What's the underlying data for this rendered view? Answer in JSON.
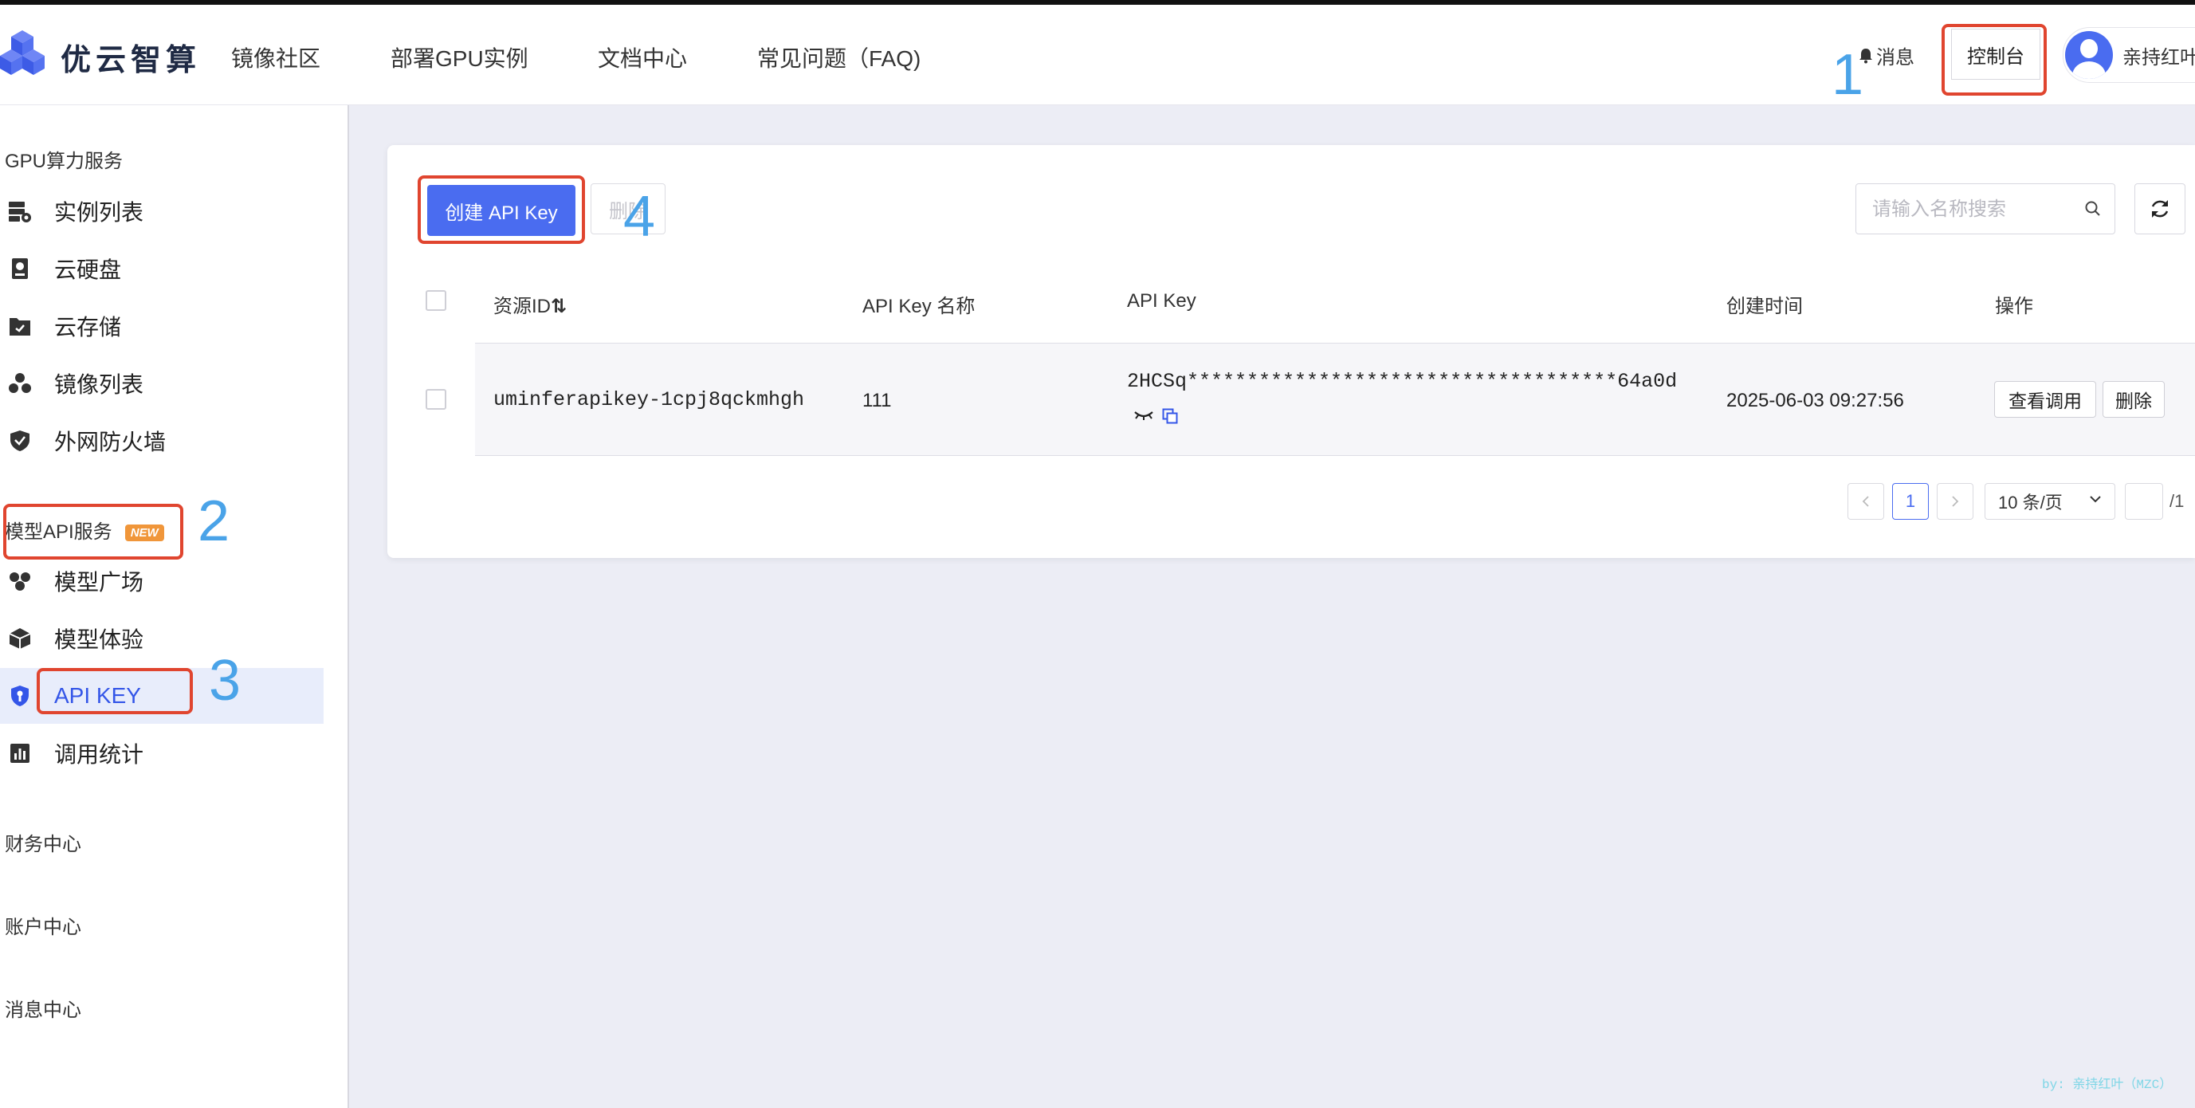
{
  "header": {
    "brand": "优云智算",
    "nav": [
      "镜像社区",
      "部署GPU实例",
      "文档中心",
      "常见问题（FAQ)"
    ],
    "messages_label": "消息",
    "console_label": "控制台",
    "username": "亲持红叶"
  },
  "sidebar": {
    "sections": {
      "gpu": "GPU算力服务",
      "model_api": "模型API服务",
      "finance": "财务中心",
      "account": "账户中心",
      "message": "消息中心"
    },
    "new_badge": "NEW",
    "gpu_items": [
      "实例列表",
      "云硬盘",
      "云存储",
      "镜像列表",
      "外网防火墙"
    ],
    "model_items": [
      "模型广场",
      "模型体验",
      "API KEY",
      "调用统计"
    ],
    "active_item": "API KEY"
  },
  "toolbar": {
    "create_label": "创建 API Key",
    "delete_label": "删除",
    "search_placeholder": "请输入名称搜索"
  },
  "table": {
    "headers": [
      "资源ID",
      "API Key 名称",
      "API Key",
      "创建时间",
      "操作"
    ],
    "sort_glyph": "⇅",
    "rows": [
      {
        "resource_id": "uminferapikey-1cpj8qckmhgh",
        "name": "111",
        "api_key": "2HCSq************************************64a0d",
        "created": "2025-06-03 09:27:56",
        "view_label": "查看调用",
        "delete_label": "删除"
      }
    ]
  },
  "pagination": {
    "current_page": "1",
    "page_size": "10 条/页",
    "total_pages": "/1"
  },
  "annotations": [
    "1",
    "2",
    "3",
    "4"
  ],
  "watermark": "by: 亲持红叶（MZC）",
  "colors": {
    "accent": "#4a6cf0",
    "annotation_box": "#e0452f",
    "annotation_number": "#4aa3e8",
    "badge": "#f0963a"
  }
}
